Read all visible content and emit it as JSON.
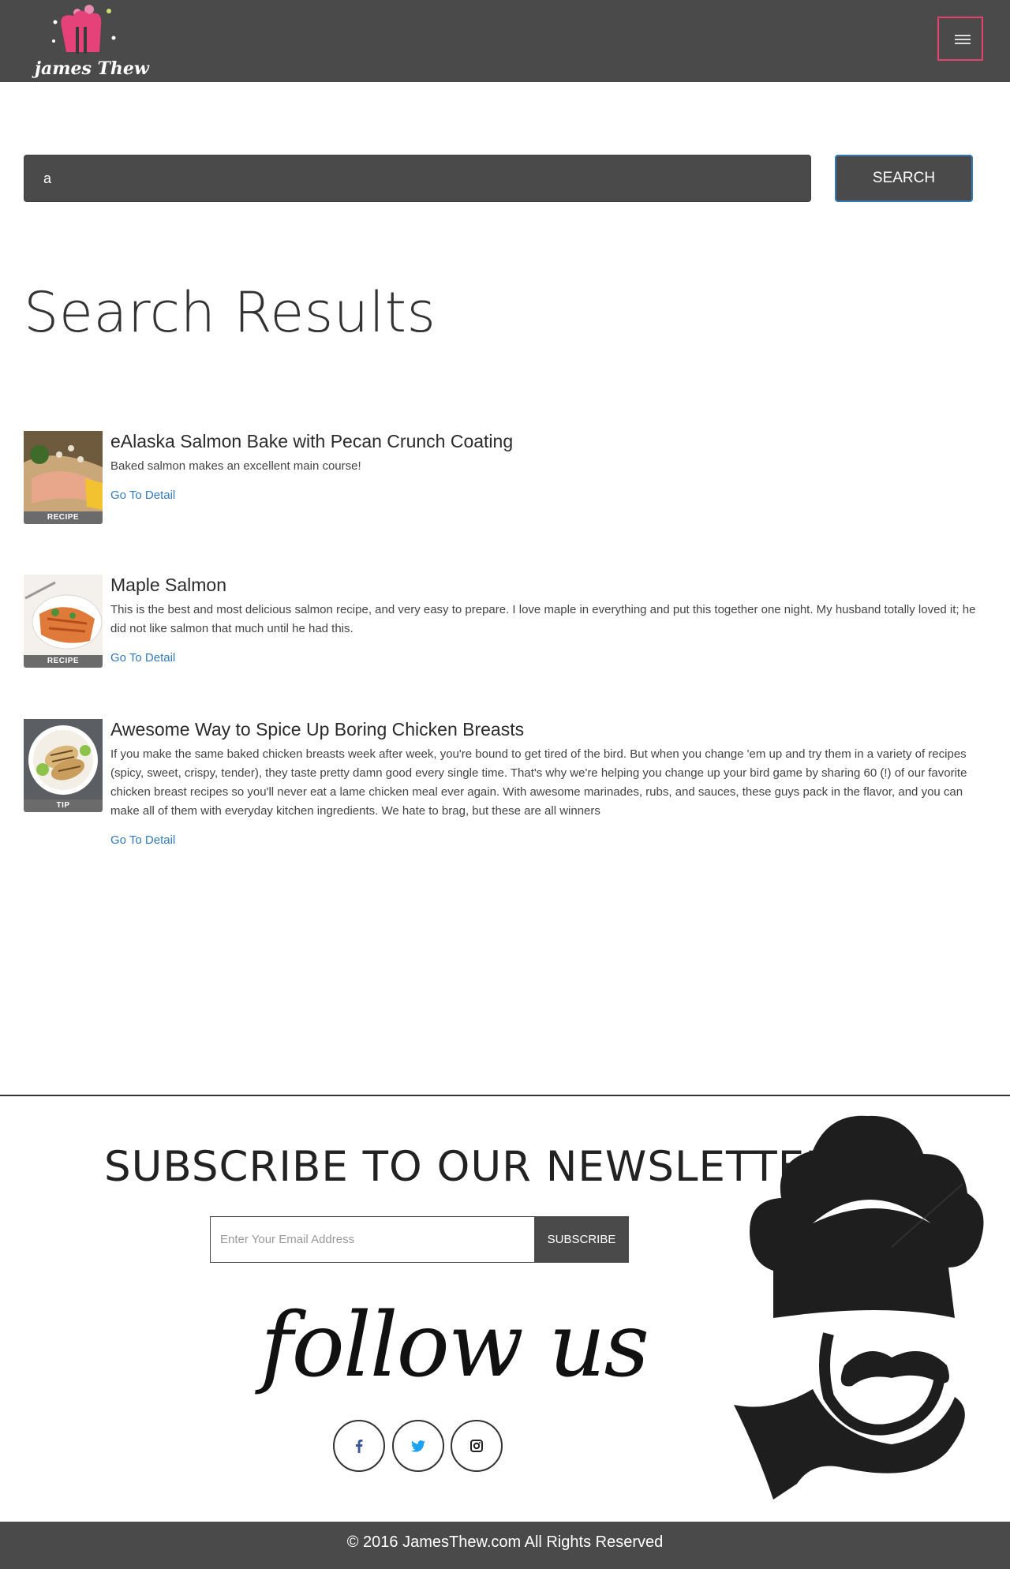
{
  "header": {
    "logo_text": "james Thew",
    "menu_icon": "hamburger-icon",
    "colors": {
      "bar": "#4a4a4a",
      "accent": "#e5426a"
    }
  },
  "search": {
    "value": "a",
    "button_label": "SEARCH"
  },
  "results": {
    "title": "Search Results",
    "items": [
      {
        "title": "eAlaska Salmon Bake with Pecan Crunch Coating",
        "description": "Baked salmon makes an excellent main course!",
        "badge": "RECIPE",
        "link": "Go To Detail"
      },
      {
        "title": "Maple Salmon",
        "description": "This is the best and most delicious salmon recipe, and very easy to prepare. I love maple in everything and put this together one night. My husband totally loved it; he did not like salmon that much until he had this.",
        "badge": "RECIPE",
        "link": "Go To Detail"
      },
      {
        "title": "Awesome Way to Spice Up Boring Chicken Breasts",
        "description": "If you make the same baked chicken breasts week after week, you're bound to get tired of the bird. But when you change 'em up and try them in a variety of recipes (spicy, sweet, crispy, tender), they taste pretty damn good every single time. That's why we're helping you change up your bird game by sharing 60 (!) of our favorite chicken breast recipes so you'll never eat a lame chicken meal ever again. With awesome marinades, rubs, and sauces, these guys pack in the flavor, and you can make all of them with everyday kitchen ingredients. We hate to brag, but these are all winners",
        "badge": "TIP",
        "link": "Go To Detail"
      }
    ]
  },
  "newsletter": {
    "title": "SUBSCRIBE TO OUR NEWSLETTER",
    "email_placeholder": "Enter Your Email Address",
    "button_label": "SUBSCRIBE"
  },
  "follow": {
    "title": "follow us",
    "socials": [
      "facebook-icon",
      "twitter-icon",
      "instagram-icon"
    ]
  },
  "footer": {
    "copyright": "© 2016 JamesThew.com All Rights Reserved"
  }
}
